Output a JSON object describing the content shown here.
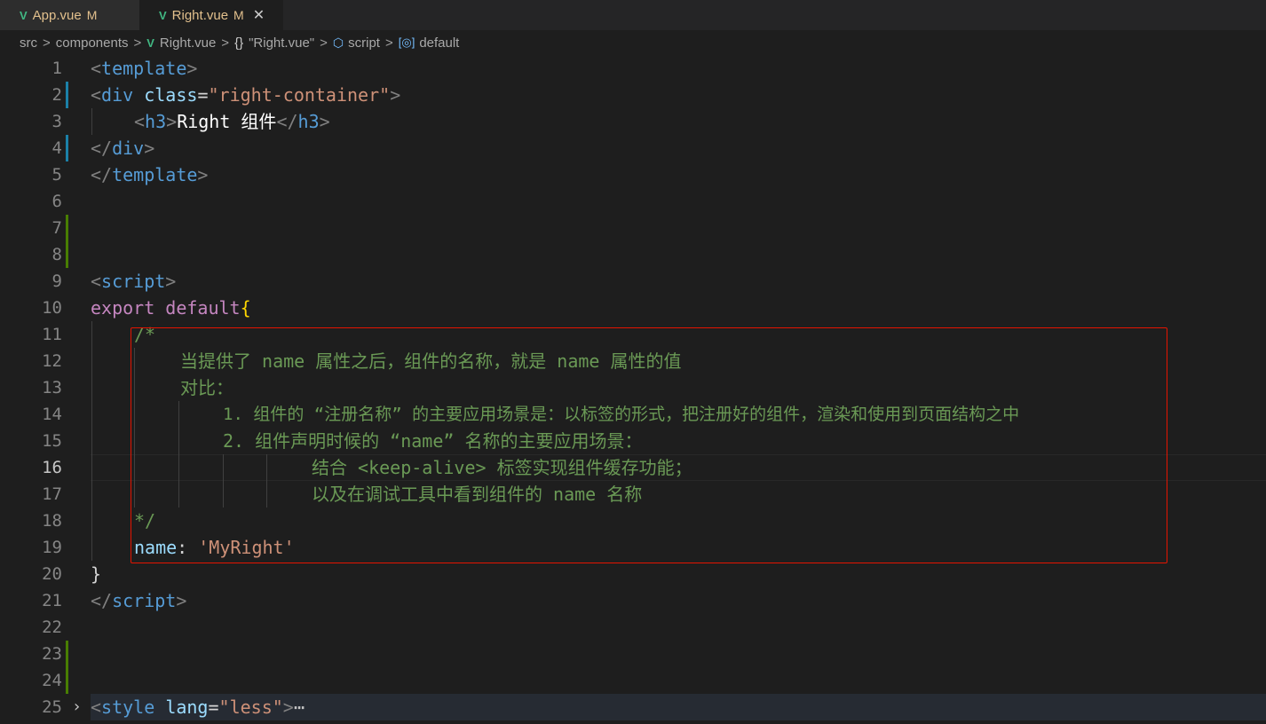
{
  "tabs": [
    {
      "label": "App.vue",
      "status": "M",
      "active": false
    },
    {
      "label": "Right.vue",
      "status": "M",
      "active": true,
      "close": "✕"
    }
  ],
  "breadcrumb": {
    "items": [
      "src",
      "components",
      "Right.vue",
      "\"Right.vue\"",
      "script",
      "default"
    ],
    "separator": ">"
  },
  "editor": {
    "active_line": 16,
    "line_numbers": [
      "1",
      "2",
      "3",
      "4",
      "5",
      "6",
      "7",
      "8",
      "9",
      "10",
      "11",
      "12",
      "13",
      "14",
      "15",
      "16",
      "17",
      "18",
      "19",
      "20",
      "21",
      "22",
      "23",
      "24",
      "25"
    ],
    "lines": {
      "l1": {
        "open": "<",
        "tag": "template",
        "close": ">"
      },
      "l2": {
        "open": "<",
        "tag": "div",
        "attr": "class",
        "eq": "=",
        "val": "\"right-container\"",
        "close": ">"
      },
      "l3": {
        "open": "<",
        "tag": "h3",
        "close": ">",
        "text": "Right 组件",
        "open2": "</",
        "tag2": "h3",
        "close2": ">"
      },
      "l4": {
        "open": "</",
        "tag": "div",
        "close": ">"
      },
      "l5": {
        "open": "</",
        "tag": "template",
        "close": ">"
      },
      "l9": {
        "open": "<",
        "tag": "script",
        "close": ">"
      },
      "l10": {
        "kw1": "export",
        "kw2": "default",
        "brace": "{"
      },
      "l11": "/*",
      "l12": "当提供了 name 属性之后，组件的名称，就是 name 属性的值",
      "l13": "对比：",
      "l14": "1. 组件的 “注册名称” 的主要应用场景是：以标签的形式，把注册好的组件，渲染和使用到页面结构之中",
      "l15": "2. 组件声明时候的 “name” 名称的主要应用场景：",
      "l16": "结合 <keep-alive> 标签实现组件缓存功能；",
      "l17": "以及在调试工具中看到组件的 name 名称",
      "l18": "*/",
      "l19": {
        "prop": "name",
        "colon": ":",
        "val": "'MyRight'"
      },
      "l20": {
        "brace": "}"
      },
      "l21": {
        "open": "</",
        "tag": "script",
        "close": ">"
      },
      "l25": {
        "open": "<",
        "tag": "style",
        "attr": "lang",
        "eq": "=",
        "val": "\"less\"",
        "close": ">",
        "ellipsis": "⋯"
      }
    }
  },
  "colors": {
    "background": "#1e1e1e",
    "highlight_box": "#e51400",
    "git_modified": "#1b81a8",
    "git_added": "#487e02"
  },
  "icons": [
    "vue-icon",
    "close-icon",
    "chevron-right-icon",
    "braces-icon",
    "cube-icon",
    "variable-icon",
    "fold-arrow-icon"
  ]
}
